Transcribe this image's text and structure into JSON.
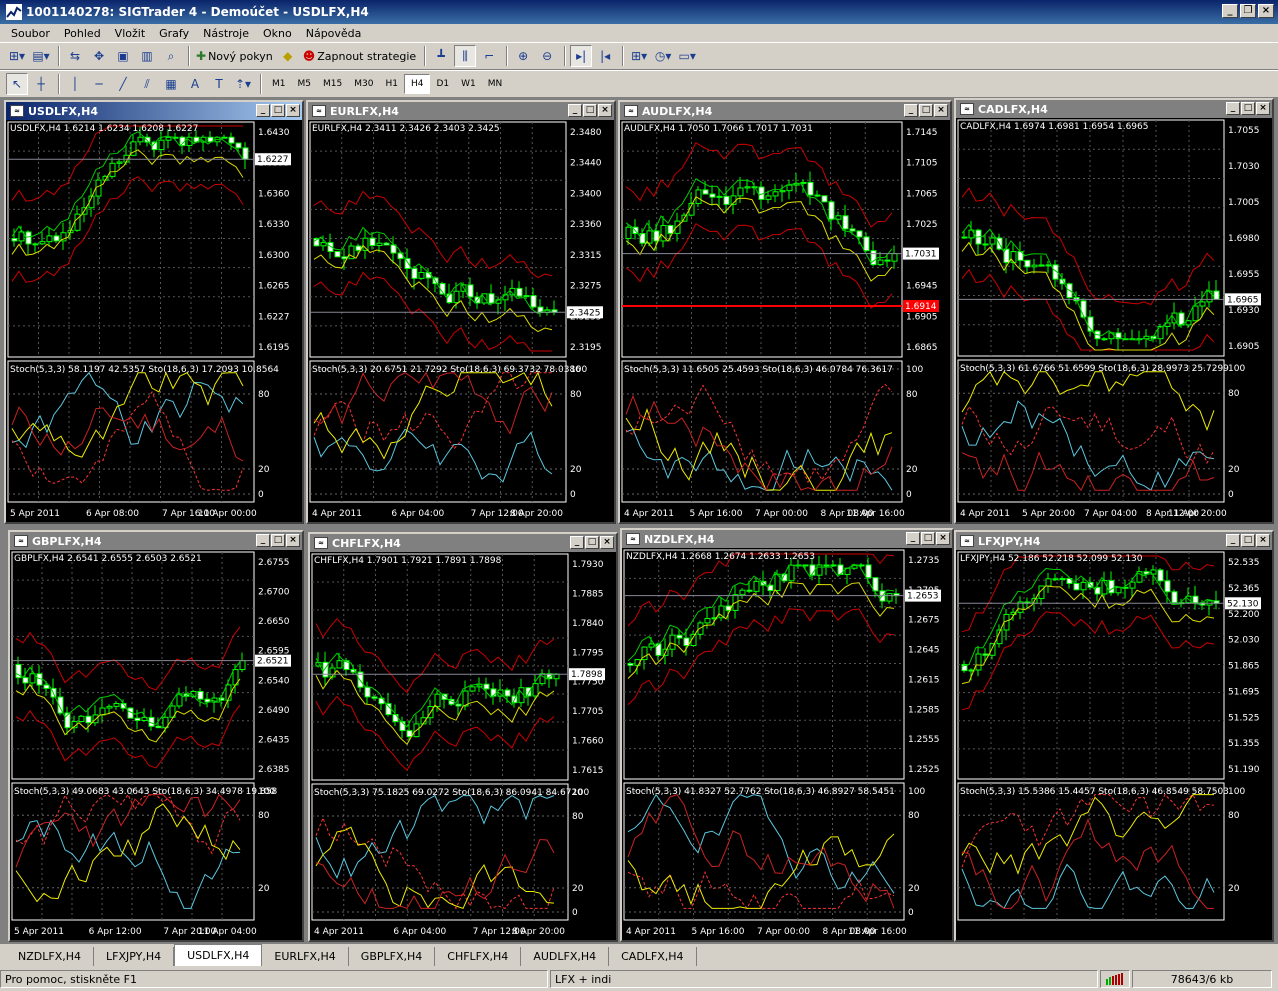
{
  "app": {
    "title": "1001140278: SIGTrader 4 - Demoúčet - USDLFX,H4"
  },
  "menu": [
    "Soubor",
    "Pohled",
    "Vložit",
    "Grafy",
    "Nástroje",
    "Okno",
    "Nápověda"
  ],
  "toolbar": {
    "new_order": "Nový pokyn",
    "strategies": "Zapnout strategie",
    "timeframes": [
      "M1",
      "M5",
      "M15",
      "M30",
      "H1",
      "H4",
      "D1",
      "W1",
      "MN"
    ],
    "active_timeframe": "H4"
  },
  "charts": [
    {
      "title": "USDLFX,H4",
      "ohlc": "USDLFX,H4  1.6214  1.6234  1.6208  1.6227",
      "current": "1.6227",
      "current_bg": "#ffffff",
      "prices": [
        "1.6430",
        "1.6395",
        "1.6360",
        "1.6330",
        "1.6300",
        "1.6265",
        "1.6227",
        "1.6195"
      ],
      "stoch": "Stoch(5,3,3) 58.1197 42.5357   Sto(18,6,3) 17.2093 10.8564",
      "dates": [
        "5 Apr 2011",
        "6 Apr 08:00",
        "7 Apr 16:00",
        "11 Apr 00:00"
      ],
      "levels": [
        "80",
        "20",
        "0"
      ]
    },
    {
      "title": "EURLFX,H4",
      "ohlc": "EURLFX,H4  2.3411  2.3426  2.3403  2.3425",
      "current": "2.3425",
      "current_bg": "#ffffff",
      "prices": [
        "2.3480",
        "2.3440",
        "2.3400",
        "2.3360",
        "2.3315",
        "2.3275",
        "2.3235",
        "2.3195"
      ],
      "stoch": "Stoch(5,3,3) 20.6751 21.7292   Sto(18,6,3) 69.3732 78.0386",
      "dates": [
        "4 Apr 2011",
        "6 Apr 04:00",
        "7 Apr 12:00",
        "8 Apr 20:00"
      ],
      "levels": [
        "100",
        "80",
        "20",
        "0"
      ]
    },
    {
      "title": "AUDLFX,H4",
      "ohlc": "AUDLFX,H4  1.7050  1.7066  1.7017  1.7031",
      "current": "1.7031",
      "current_bg": "#ffffff",
      "alert": "1.6914",
      "prices": [
        "1.7145",
        "1.7105",
        "1.7065",
        "1.7025",
        "1.6985",
        "1.6945",
        "1.6905",
        "1.6865"
      ],
      "stoch": "Stoch(5,3,3) 11.6505 25.4593   Sto(18,6,3) 46.0784 76.3617",
      "dates": [
        "4 Apr 2011",
        "5 Apr 16:00",
        "7 Apr 00:00",
        "8 Apr 08:00",
        "11 Apr 16:00"
      ],
      "levels": [
        "100",
        "80",
        "20",
        "0"
      ]
    },
    {
      "title": "CADLFX,H4",
      "ohlc": "CADLFX,H4  1.6974  1.6981  1.6954  1.6965",
      "current": "1.6965",
      "current_bg": "#ffffff",
      "prices": [
        "1.7055",
        "1.7030",
        "1.7005",
        "1.6980",
        "1.6955",
        "1.6930",
        "1.6905"
      ],
      "stoch": "Stoch(5,3,3) 61.6766 51.6599   Sto(18,6,3) 28.9973 25.7299",
      "dates": [
        "4 Apr 2011",
        "5 Apr 20:00",
        "7 Apr 04:00",
        "8 Apr 12:00",
        "11 Apr 20:00"
      ],
      "levels": [
        "100",
        "80",
        "20",
        "0"
      ]
    },
    {
      "title": "GBPLFX,H4",
      "ohlc": "GBPLFX,H4  2.6541  2.6555  2.6503  2.6521",
      "current": "2.6521",
      "current_bg": "#ffffff",
      "prices": [
        "2.6755",
        "2.6700",
        "2.6650",
        "2.6595",
        "2.6540",
        "2.6490",
        "2.6435",
        "2.6385"
      ],
      "stoch": "Stoch(5,3,3) 49.0683 43.0643   Sto(18,6,3) 34.4978 19.858",
      "dates": [
        "5 Apr 2011",
        "6 Apr 12:00",
        "7 Apr 20:00",
        "11 Apr 04:00"
      ],
      "levels": [
        "100",
        "80",
        "20"
      ]
    },
    {
      "title": "CHFLFX,H4",
      "ohlc": "CHFLFX,H4  1.7901  1.7921  1.7891  1.7898",
      "current": "1.7898",
      "current_bg": "#ffffff",
      "prices": [
        "1.7930",
        "1.7885",
        "1.7840",
        "1.7795",
        "1.7750",
        "1.7705",
        "1.7660",
        "1.7615"
      ],
      "stoch": "Stoch(5,3,3) 75.1825 69.0272   Sto(18,6,3) 86.0941 84.6720",
      "dates": [
        "4 Apr 2011",
        "6 Apr 04:00",
        "7 Apr 12:00",
        "8 Apr 20:00"
      ],
      "levels": [
        "100",
        "80",
        "20",
        "0"
      ]
    },
    {
      "title": "NZDLFX,H4",
      "ohlc": "NZDLFX,H4  1.2668  1.2674  1.2633  1.2653",
      "current": "1.2653",
      "current_bg": "#ffffff",
      "prices": [
        "1.2735",
        "1.2705",
        "1.2675",
        "1.2645",
        "1.2615",
        "1.2585",
        "1.2555",
        "1.2525"
      ],
      "stoch": "Stoch(5,3,3) 41.8327 52.7762   Sto(18,6,3) 46.8927 58.5451",
      "dates": [
        "4 Apr 2011",
        "5 Apr 16:00",
        "7 Apr 00:00",
        "8 Apr 08:00",
        "11 Apr 16:00"
      ],
      "levels": [
        "100",
        "80",
        "20",
        "0"
      ]
    },
    {
      "title": "LFXJPY,H4",
      "ohlc": "LFXJPY,H4  52.186  52.218  52.099  52.130",
      "current": "52.130",
      "current_bg": "#ffffff",
      "prices": [
        "52.535",
        "52.365",
        "52.200",
        "52.030",
        "51.865",
        "51.695",
        "51.525",
        "51.355",
        "51.190"
      ],
      "stoch": "Stoch(5,3,3) 15.5386 15.4457   Sto(18,6,3) 46.8549 58.7503",
      "dates": [],
      "levels": [
        "100",
        "80",
        "20"
      ]
    }
  ],
  "tabs": [
    "NZDLFX,H4",
    "LFXJPY,H4",
    "USDLFX,H4",
    "EURLFX,H4",
    "GBPLFX,H4",
    "CHFLFX,H4",
    "AUDLFX,H4",
    "CADLFX,H4"
  ],
  "active_tab": "USDLFX,H4",
  "status": {
    "help": "Pro pomoc, stiskněte F1",
    "profile": "LFX + indi",
    "traffic": "78643/6 kb"
  }
}
